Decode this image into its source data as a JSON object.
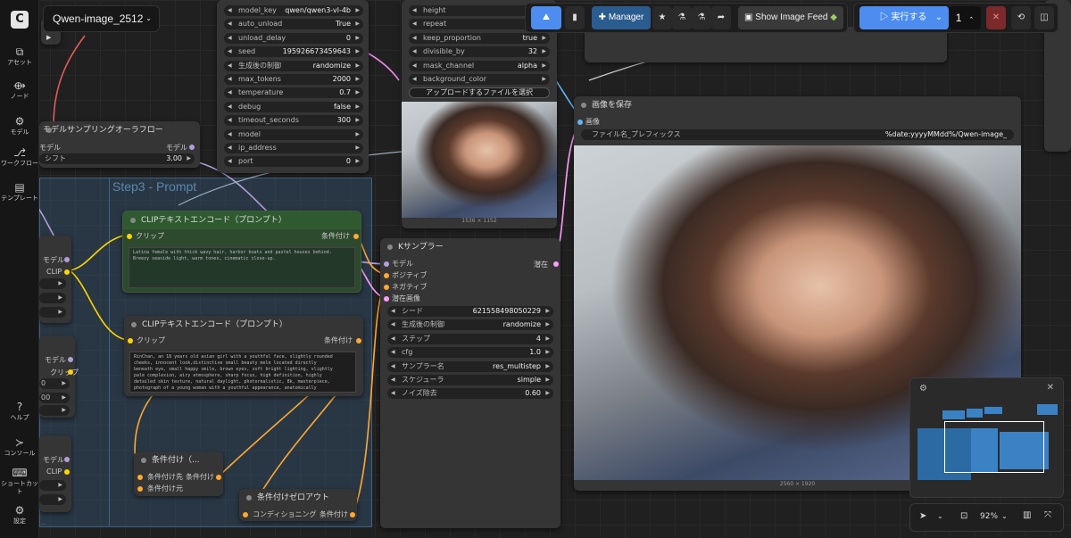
{
  "workflow": {
    "name": "Qwen-image_2512",
    "caret": "⌄"
  },
  "sidebar": {
    "items": [
      {
        "label": "アセット",
        "icon": "assets-icon"
      },
      {
        "label": "ノード",
        "icon": "node-icon"
      },
      {
        "label": "モデル",
        "icon": "model-icon"
      },
      {
        "label": "ワークフロー",
        "icon": "workflow-icon"
      },
      {
        "label": "テンプレート",
        "icon": "template-icon"
      },
      {
        "label": "ヘルプ",
        "icon": "help-icon"
      },
      {
        "label": "コンソール",
        "icon": "console-icon"
      },
      {
        "label": "ショートカット",
        "icon": "keyboard-icon"
      },
      {
        "label": "設定",
        "icon": "settings-icon"
      }
    ]
  },
  "llm_node": {
    "widgets": [
      {
        "key": "model_key",
        "value": "qwen/qwen3-vl-4b"
      },
      {
        "key": "auto_unload",
        "value": "True"
      },
      {
        "key": "unload_delay",
        "value": "0"
      },
      {
        "key": "seed",
        "value": "195926673459643"
      },
      {
        "key": "生成後の制御",
        "value": "randomize"
      },
      {
        "key": "max_tokens",
        "value": "2000"
      },
      {
        "key": "temperature",
        "value": "0.7"
      },
      {
        "key": "debug",
        "value": "false"
      },
      {
        "key": "timeout_seconds",
        "value": "300"
      },
      {
        "key": "model",
        "value": ""
      },
      {
        "key": "ip_address",
        "value": ""
      },
      {
        "key": "port",
        "value": "0"
      }
    ]
  },
  "resize_node": {
    "widgets": [
      {
        "key": "height",
        "value": "12"
      },
      {
        "key": "repeat",
        "value": ""
      },
      {
        "key": "keep_proportion",
        "value": "true"
      },
      {
        "key": "divisible_by",
        "value": "32"
      },
      {
        "key": "mask_channel",
        "value": "alpha"
      },
      {
        "key": "background_color",
        "value": ""
      }
    ],
    "upload_label": "アップロードするファイルを選択",
    "image_size": "1536 × 1152"
  },
  "sampling_node": {
    "title": "モデルサンプリングオーラフロー",
    "in_label": "モデル",
    "out_label": "モデル",
    "widget_key": "シフト",
    "widget_value": "3.00"
  },
  "group": {
    "title": "Step3 - Prompt"
  },
  "clip_pos": {
    "title": "CLIPテキストエンコード（プロンプト）",
    "in_label": "クリップ",
    "out_label": "条件付け",
    "text": "Latina female with thick wavy hair, harbor boats and pastel houses behind.\nBreezy seaside light, warm tones, cinematic close-up."
  },
  "clip_neg": {
    "title": "CLIPテキストエンコード（プロンプト）",
    "in_label": "クリップ",
    "out_label": "条件付け",
    "text": "RinChan, an 18 years old asian girl with a youthful face, slightly rounded\ncheeks, innocent look,distinctive small beauty mole located directly\nbeneath eye, small happy smile, brown eyes, soft bright lighting, slightly\npale complexion, airy atmosphere, sharp focus, high definition, highly\ndetailed skin texture, natural daylight, photorealistic, 8k, masterpiece,\nphotograph of a young woman with a youthful appearance, anatomically"
  },
  "left_nodes": {
    "a": {
      "model": "モデル",
      "clip": "CLIP"
    },
    "b": {
      "model": "モデル",
      "clip": "クリップ",
      "val": "00"
    },
    "c": {
      "model": "モデル",
      "clip": "CLIP"
    }
  },
  "cond_combine": {
    "title": "条件付け（...",
    "in1": "条件付け先",
    "in2": "条件付け元",
    "out": "条件付け"
  },
  "cond_zero": {
    "title": "条件付けゼロアウト",
    "in": "コンディショニング",
    "out": "条件付け"
  },
  "ksampler": {
    "title": "Kサンプラー",
    "inputs": [
      "モデル",
      "ポジティブ",
      "ネガティブ",
      "潜在画像"
    ],
    "output": "潜在",
    "widgets": [
      {
        "key": "シード",
        "value": "621558498050229"
      },
      {
        "key": "生成後の制御",
        "value": "randomize"
      },
      {
        "key": "ステップ",
        "value": "4"
      },
      {
        "key": "cfg",
        "value": "1.0"
      },
      {
        "key": "サンプラー名",
        "value": "res_multistep"
      },
      {
        "key": "スケジューラ",
        "value": "simple"
      },
      {
        "key": "ノイズ除去",
        "value": "0.60"
      }
    ]
  },
  "save_node": {
    "title": "画像を保存",
    "in_label": "画像",
    "prefix_key": "ファイル名_プレフィックス",
    "prefix_value": "%date:yyyyMMdd%/Qwen-image_",
    "image_size": "2560 × 1920"
  },
  "toolbar": {
    "manager_label": "Manager",
    "image_feed_label": "Show Image Feed",
    "run_label": "実行する",
    "queue_count": "1"
  },
  "bottombar": {
    "zoom": "92%"
  },
  "colors": {
    "accent": "#3b82f6",
    "run": "#4d8df0",
    "link_model": "#b39ddb",
    "link_clip": "#ffd500",
    "link_cond": "#ffa931",
    "link_latent": "#ff9cf9"
  }
}
